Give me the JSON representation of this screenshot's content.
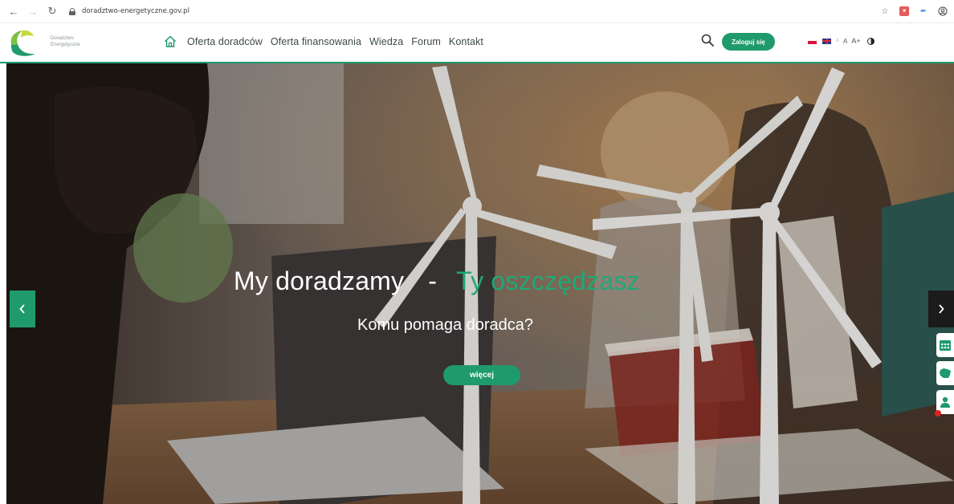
{
  "browser": {
    "url": "doradztwo-energetyczne.gov.pl",
    "back_icon": "arrow-left-icon",
    "forward_icon": "arrow-right-icon",
    "reload_icon": "reload-icon"
  },
  "logo": {
    "line1": "Doradztwo",
    "line2": "Energetyczne"
  },
  "nav": {
    "items": [
      {
        "label": "Oferta doradców"
      },
      {
        "label": "Oferta finansowania"
      },
      {
        "label": "Wiedza"
      },
      {
        "label": "Forum"
      },
      {
        "label": "Kontakt"
      }
    ]
  },
  "header": {
    "login_label": "Zaloguj się",
    "font_small": "A",
    "font_medium": "A",
    "font_large": "A+"
  },
  "hero": {
    "title_left": "My doradzamy",
    "title_dash": "-",
    "title_right": "Ty oszczędzasz",
    "subtitle": "Komu pomaga doradca?",
    "more_label": "więcej"
  },
  "colors": {
    "brand_green": "#1f9a6c",
    "accent_green_text": "#1fa876"
  }
}
